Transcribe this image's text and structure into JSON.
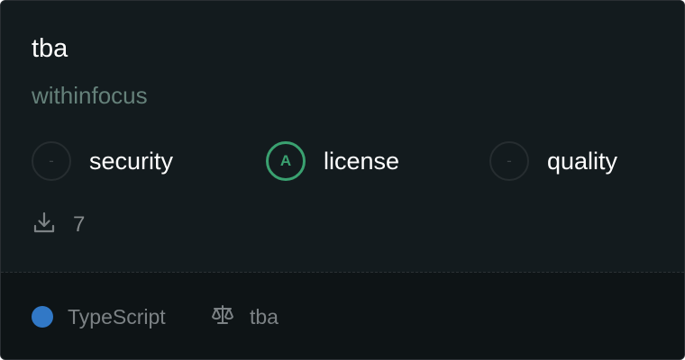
{
  "card": {
    "title": "tba",
    "owner": "withinfocus",
    "scores": [
      {
        "grade": "-",
        "label": "security",
        "style": "empty"
      },
      {
        "grade": "A",
        "label": "license",
        "style": "grade-a"
      },
      {
        "grade": "-",
        "label": "quality",
        "style": "empty"
      }
    ],
    "downloads": {
      "icon": "download-icon",
      "count": "7"
    },
    "footer": {
      "language": "TypeScript",
      "language_color": "#3178c6",
      "license_icon": "scale-icon",
      "license": "tba"
    }
  },
  "colors": {
    "card_background": "#131b1e",
    "footer_background": "#0e1416",
    "owner_text": "#65817a",
    "grade_a": "#3aa170",
    "muted_text": "#7c8285"
  }
}
